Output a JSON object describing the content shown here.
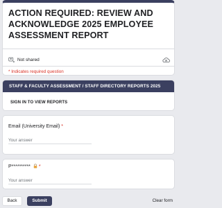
{
  "form": {
    "title": "ACTION REQUIRED: REVIEW AND ACKNOWLEDGE 2025 EMPLOYEE ASSESSMENT REPORT",
    "account_status": "Not shared",
    "required_note": "* Indicates required question",
    "account_icon": "account-switch-icon",
    "cloud_icon": "cloud-off-icon",
    "accent_color": "#3b4060"
  },
  "section": {
    "header": "STAFF & FACULTY ASSESSMENT / STAFF DIRECTORY REPORTS 2025",
    "description": "SIGN IN TO VIEW REPORTS"
  },
  "questions": [
    {
      "label": "Email (University Email)",
      "required_mark": "*",
      "placeholder": "Your answer"
    },
    {
      "label": "P**********",
      "required_mark": "*",
      "placeholder": "Your answer",
      "icon": "lock-icon"
    }
  ],
  "footer": {
    "back_label": "Back",
    "submit_label": "Submit",
    "clear_label": "Clear form"
  }
}
